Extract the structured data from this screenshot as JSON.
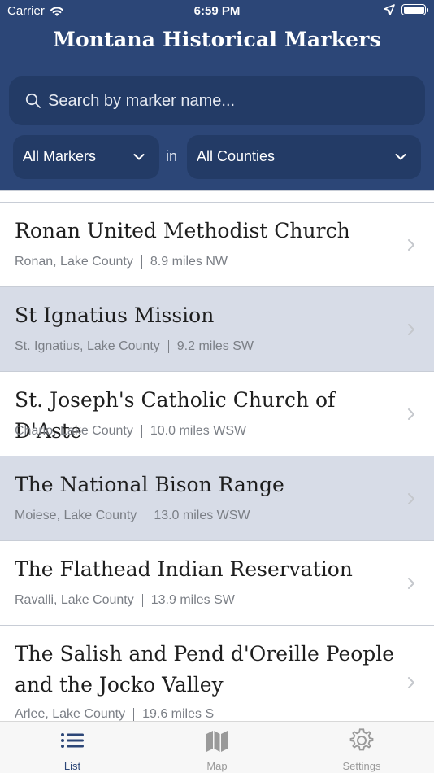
{
  "status_bar": {
    "carrier": "Carrier",
    "time": "6:59 PM"
  },
  "header": {
    "title": "Montana Historical Markers"
  },
  "search": {
    "placeholder": "Search by marker name..."
  },
  "filters": {
    "marker_type": "All Markers",
    "in_label": "in",
    "county": "All Counties"
  },
  "list": {
    "items": [
      {
        "title": "Ronan United Methodist Church",
        "location": "Ronan, Lake County",
        "distance": "8.9 miles NW"
      },
      {
        "title": "St Ignatius Mission",
        "location": "St. Ignatius, Lake County",
        "distance": "9.2 miles SW"
      },
      {
        "title": "St. Joseph's Catholic Church of D'Aste",
        "location": "Charlo, Lake County",
        "distance": "10.0 miles WSW"
      },
      {
        "title": "The National Bison Range",
        "location": "Moiese, Lake County",
        "distance": "13.0 miles WSW"
      },
      {
        "title": "The Flathead Indian Reservation",
        "location": "Ravalli, Lake County",
        "distance": "13.9 miles SW"
      },
      {
        "title": "The Salish and Pend d'Oreille People and the Jocko Valley",
        "location": "Arlee, Lake County",
        "distance": "19.6 miles S"
      }
    ]
  },
  "tabbar": {
    "tabs": [
      {
        "label": "List"
      },
      {
        "label": "Map"
      },
      {
        "label": "Settings"
      }
    ]
  },
  "colors": {
    "header_bg": "#2c4677",
    "input_bg": "#233b66",
    "shaded_row": "#d7dce7",
    "tab_active": "#2c4677",
    "tab_inactive": "#9a9a9a"
  }
}
